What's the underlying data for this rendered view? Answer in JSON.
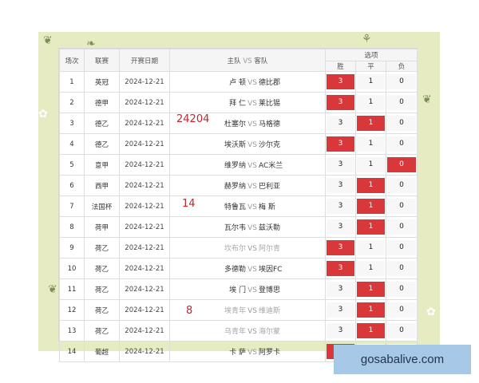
{
  "header": {
    "round": "场次",
    "league": "联赛",
    "date": "开赛日期",
    "home": "主队",
    "vs": "VS",
    "away": "客队",
    "options": "选项",
    "win": "胜",
    "draw": "平",
    "loss": "负"
  },
  "rows": [
    {
      "no": "1",
      "league": "英冠",
      "date": "2024-12-21",
      "home": "卢 顿",
      "vs": "VS",
      "away": "德比郡",
      "o3": "3",
      "o1": "1",
      "o0": "0",
      "sel": "win",
      "dim": false
    },
    {
      "no": "2",
      "league": "德甲",
      "date": "2024-12-21",
      "home": "拜 仁",
      "vs": "VS",
      "away": "莱比锡",
      "o3": "3",
      "o1": "1",
      "o0": "0",
      "sel": "win",
      "dim": false
    },
    {
      "no": "3",
      "league": "德乙",
      "date": "2024-12-21",
      "home": "杜塞尔",
      "vs": "VS",
      "away": "马格德",
      "o3": "3",
      "o1": "1",
      "o0": "0",
      "sel": "draw",
      "dim": false
    },
    {
      "no": "4",
      "league": "德乙",
      "date": "2024-12-21",
      "home": "埃沃斯",
      "vs": "VS",
      "away": "沙尔克",
      "o3": "3",
      "o1": "1",
      "o0": "0",
      "sel": "win",
      "dim": false
    },
    {
      "no": "5",
      "league": "意甲",
      "date": "2024-12-21",
      "home": "维罗纳",
      "vs": "VS",
      "away": "AC米兰",
      "o3": "3",
      "o1": "1",
      "o0": "0",
      "sel": "loss",
      "dim": false
    },
    {
      "no": "6",
      "league": "西甲",
      "date": "2024-12-21",
      "home": "赫罗纳",
      "vs": "VS",
      "away": "巴利亚",
      "o3": "3",
      "o1": "1",
      "o0": "0",
      "sel": "draw",
      "dim": false
    },
    {
      "no": "7",
      "league": "法国杯",
      "date": "2024-12-21",
      "home": "特鲁瓦",
      "vs": "VS",
      "away": "梅 斯",
      "o3": "3",
      "o1": "1",
      "o0": "0",
      "sel": "draw",
      "dim": false
    },
    {
      "no": "8",
      "league": "荷甲",
      "date": "2024-12-21",
      "home": "瓦尔韦",
      "vs": "VS",
      "away": "兹沃勒",
      "o3": "3",
      "o1": "1",
      "o0": "0",
      "sel": "draw",
      "dim": false
    },
    {
      "no": "9",
      "league": "荷乙",
      "date": "2024-12-21",
      "home": "坎布尔",
      "vs": "VS",
      "away": "阿尔青",
      "o3": "3",
      "o1": "1",
      "o0": "0",
      "sel": "win",
      "dim": true
    },
    {
      "no": "10",
      "league": "荷乙",
      "date": "2024-12-21",
      "home": "多德勒",
      "vs": "VS",
      "away": "埃因FC",
      "o3": "3",
      "o1": "1",
      "o0": "0",
      "sel": "win",
      "dim": false
    },
    {
      "no": "11",
      "league": "荷乙",
      "date": "2024-12-21",
      "home": "埃 门",
      "vs": "VS",
      "away": "登博思",
      "o3": "3",
      "o1": "1",
      "o0": "0",
      "sel": "draw",
      "dim": false
    },
    {
      "no": "12",
      "league": "荷乙",
      "date": "2024-12-21",
      "home": "埃青年",
      "vs": "VS",
      "away": "维迪斯",
      "o3": "3",
      "o1": "1",
      "o0": "0",
      "sel": "draw",
      "dim": true
    },
    {
      "no": "13",
      "league": "荷乙",
      "date": "2024-12-21",
      "home": "乌青年",
      "vs": "VS",
      "away": "海尔蒙",
      "o3": "3",
      "o1": "1",
      "o0": "0",
      "sel": "draw",
      "dim": true
    },
    {
      "no": "14",
      "league": "葡超",
      "date": "2024-12-21",
      "home": "卡 萨",
      "vs": "VS",
      "away": "阿罗卡",
      "o3": "3",
      "o1": "θ",
      "o0": "θ",
      "sel": "win",
      "dim": false
    }
  ],
  "annotations": [
    "24204",
    "14",
    "8"
  ],
  "watermark": "gosabalive.com",
  "colors": {
    "selected": "#d9383b",
    "background": "#e7ebc2"
  }
}
